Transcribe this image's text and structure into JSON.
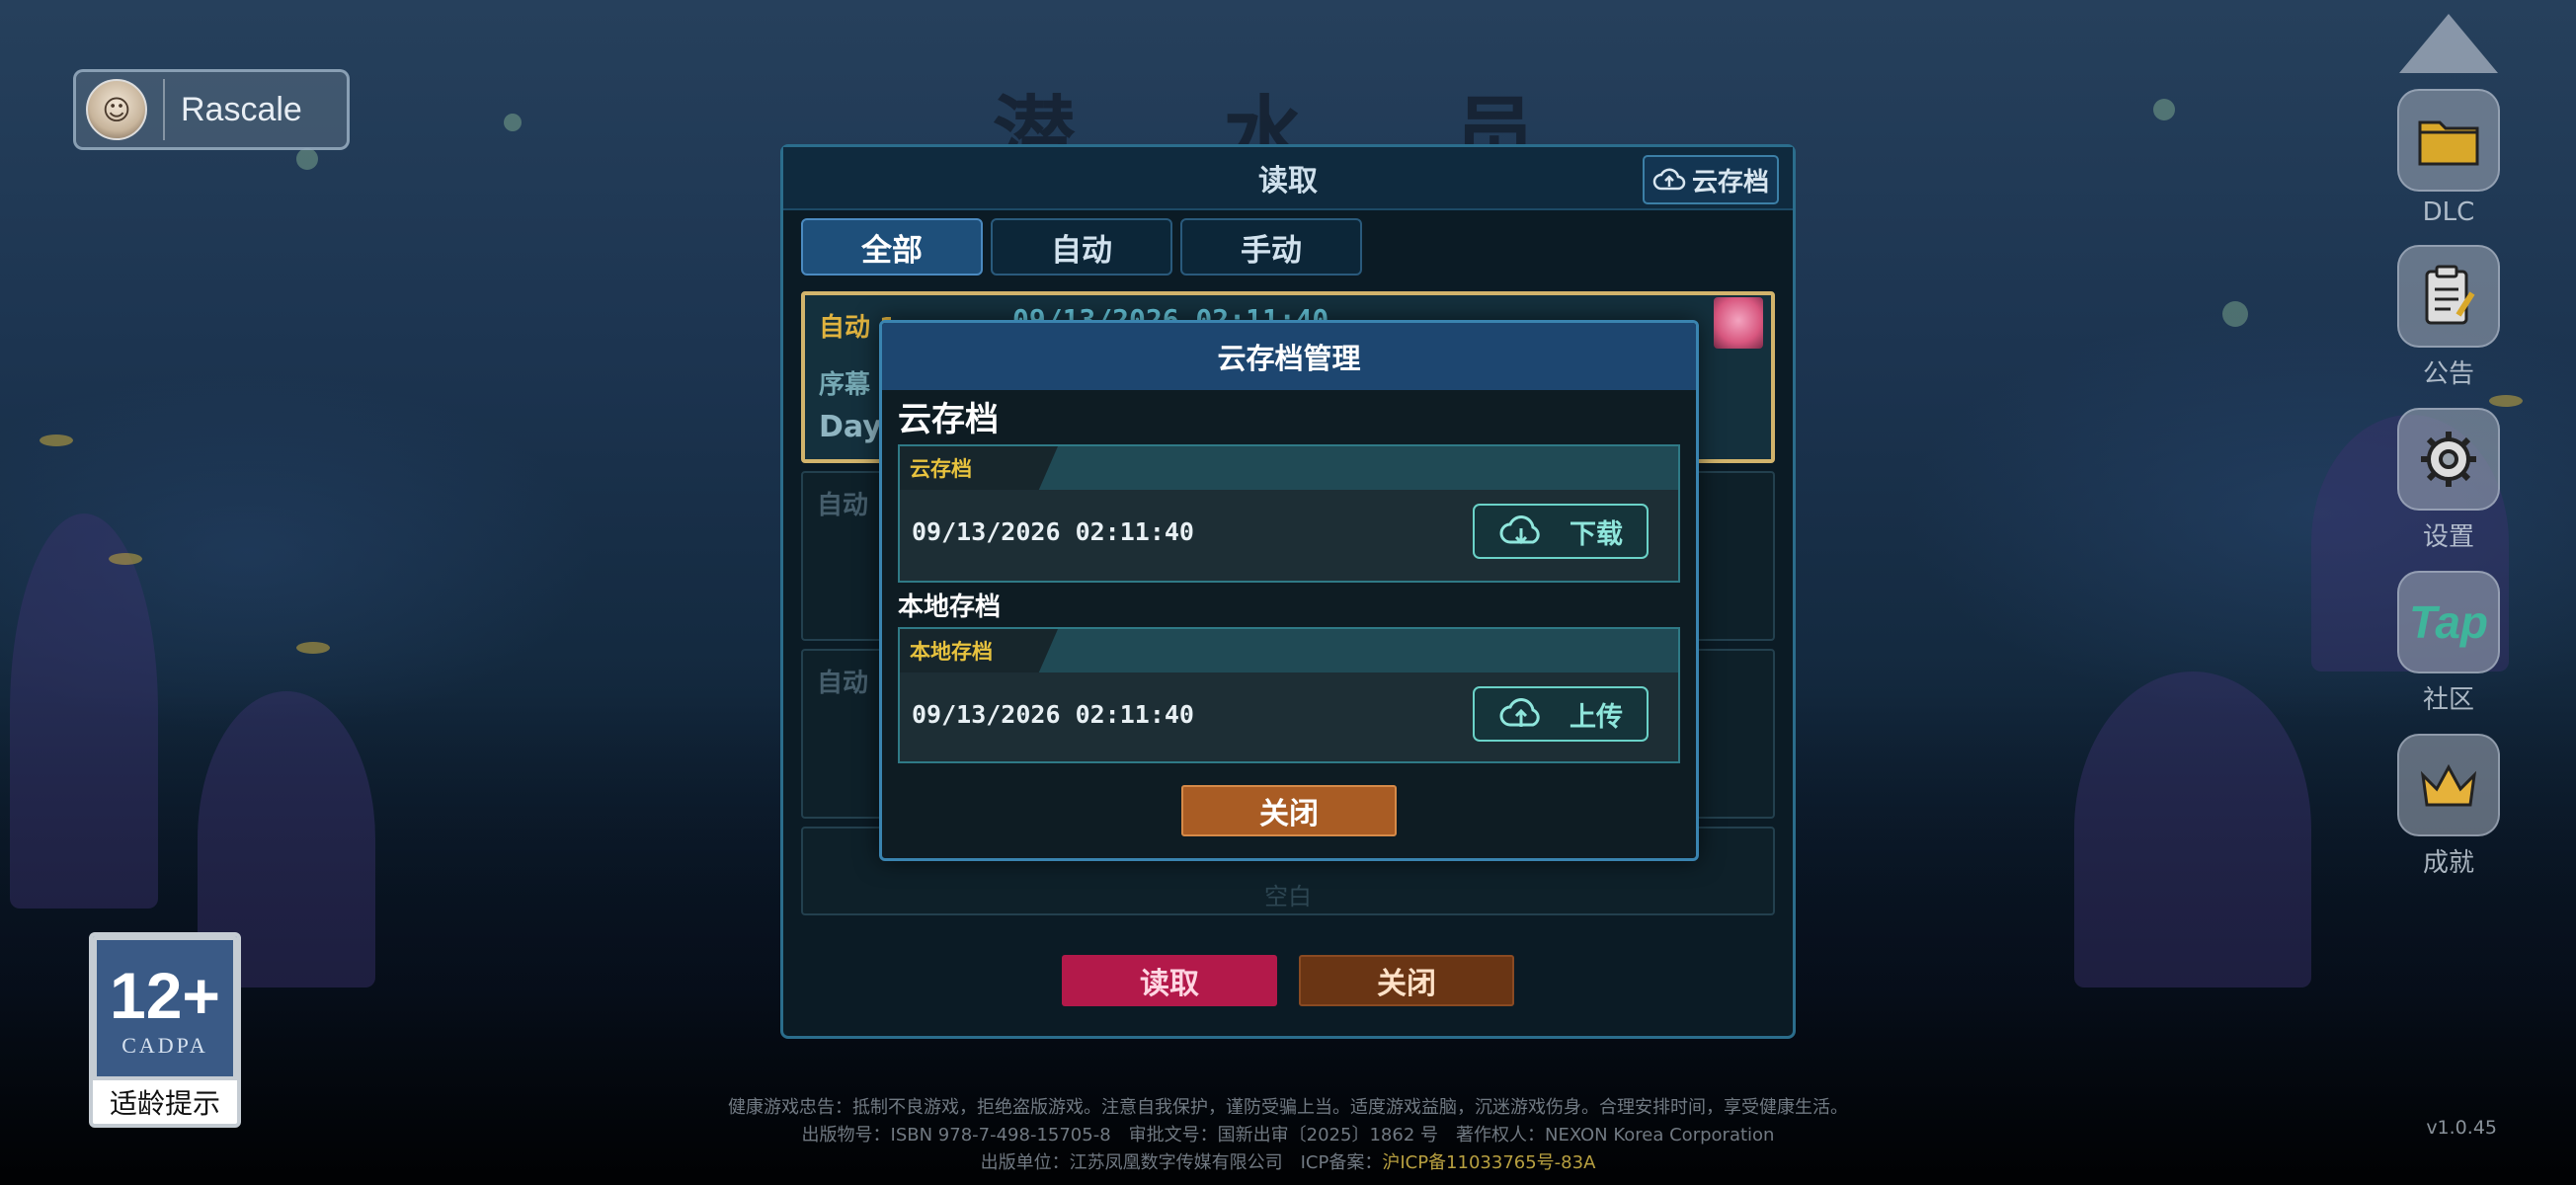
{
  "player": {
    "name": "Rascale"
  },
  "game_title": "潜 水 员",
  "side_menu": {
    "items": [
      {
        "label": "DLC",
        "icon": "folder-icon"
      },
      {
        "label": "公告",
        "icon": "notice-icon"
      },
      {
        "label": "设置",
        "icon": "gear-icon"
      },
      {
        "label": "社区",
        "icon": "taptap-icon",
        "logo_text": "Tap"
      },
      {
        "label": "成就",
        "icon": "crown-icon"
      }
    ]
  },
  "load_panel": {
    "title": "读取",
    "cloud_button": "云存档",
    "tabs": [
      "全部",
      "自动",
      "手动"
    ],
    "slots": [
      {
        "label": "自动 1",
        "date": "09/13/2026 02:11:40",
        "chapter": "序幕",
        "day": "DayC"
      },
      {
        "label": "自动"
      },
      {
        "label": "自动"
      },
      {
        "empty_text": "空白"
      }
    ],
    "read_button": "读取",
    "close_button": "关闭"
  },
  "cloud_dialog": {
    "title": "云存档管理",
    "cloud_section": "云存档",
    "cloud_entry": {
      "tag": "云存档",
      "date": "09/13/2026 02:11:40",
      "button": "下载"
    },
    "local_section": "本地存档",
    "local_entry": {
      "tag": "本地存档",
      "date": "09/13/2026 02:11:40",
      "button": "上传"
    },
    "close_button": "关闭"
  },
  "age_rating": {
    "age": "12+",
    "org": "CADPA",
    "tip": "适龄提示"
  },
  "footer": {
    "line1": "健康游戏忠告：抵制不良游戏，拒绝盗版游戏。注意自我保护，谨防受骗上当。适度游戏益脑，沉迷游戏伤身。合理安排时间，享受健康生活。",
    "line2": "出版物号：ISBN 978-7-498-15705-8　审批文号：国新出审〔2025〕1862 号　著作权人：NEXON Korea Corporation",
    "line3_prefix": "出版单位：江苏凤凰数字传媒有限公司　ICP备案：",
    "icp": "沪ICP备11033765号-83A"
  },
  "version": "v1.0.45",
  "colors": {
    "accent_gold": "#e0b33f",
    "read_button": "#b3194a",
    "close_button": "#a95c24",
    "dialog_header": "#1d4670"
  }
}
